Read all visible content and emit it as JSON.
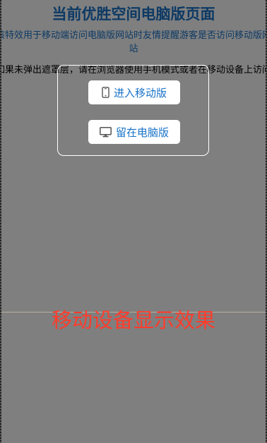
{
  "page": {
    "title": "当前优胜空间电脑版页面",
    "subtitle": "该特效用于移动端访问电脑版网站时友情提醒游客是否访问移动版网站",
    "tip": "如果未弹出遮罩层，请在浏览器使用手机模式或者在移动设备上访问",
    "effect_label": "移动设备显示效果"
  },
  "modal": {
    "mobile_button_label": "进入移动版",
    "mobile_button_icon": "mobile-phone-icon",
    "desktop_button_label": "留在电脑版",
    "desktop_button_icon": "desktop-monitor-icon"
  },
  "colors": {
    "accent": "#1a73c8",
    "effect_text": "#ff3c2c",
    "overlay": "#808080"
  }
}
